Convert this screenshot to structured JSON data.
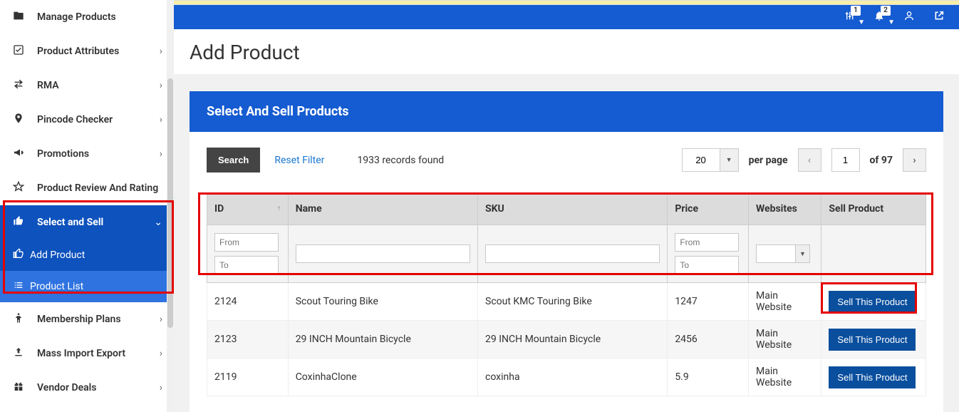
{
  "sidebar": {
    "items": [
      {
        "icon": "folder",
        "label": "Manage Products",
        "hasSub": false
      },
      {
        "icon": "check",
        "label": "Product Attributes",
        "hasSub": true
      },
      {
        "icon": "swap",
        "label": "RMA",
        "hasSub": true
      },
      {
        "icon": "pin",
        "label": "Pincode Checker",
        "hasSub": true
      },
      {
        "icon": "bullhorn",
        "label": "Promotions",
        "hasSub": true
      },
      {
        "icon": "star",
        "label": "Product Review And Rating",
        "hasSub": false
      },
      {
        "icon": "thumbup",
        "label": "Select and Sell",
        "hasSub": true,
        "active": true
      },
      {
        "icon": "body",
        "label": "Membership Plans",
        "hasSub": true
      },
      {
        "icon": "upload",
        "label": "Mass Import Export",
        "hasSub": true
      },
      {
        "icon": "gift",
        "label": "Vendor Deals",
        "hasSub": true
      }
    ],
    "subitems": [
      {
        "icon": "thumbup",
        "label": "Add Product"
      },
      {
        "icon": "list",
        "label": "Product List"
      }
    ]
  },
  "topbar": {
    "badge1": "1",
    "badge2": "2"
  },
  "page": {
    "title": "Add Product",
    "panelTitle": "Select And Sell Products"
  },
  "toolbar": {
    "search": "Search",
    "reset": "Reset Filter",
    "records": "1933 records found",
    "perpage_value": "20",
    "perpage_label": "per page",
    "page_value": "1",
    "page_of": "of 97"
  },
  "grid": {
    "headers": {
      "id": "ID",
      "name": "Name",
      "sku": "SKU",
      "price": "Price",
      "websites": "Websites",
      "sell": "Sell Product"
    },
    "filters": {
      "from": "From",
      "to": "To"
    },
    "rows": [
      {
        "id": "2124",
        "name": "Scout Touring Bike",
        "sku": "Scout KMC Touring Bike",
        "price": "1247",
        "websites": "Main Website",
        "btn": "Sell This Product"
      },
      {
        "id": "2123",
        "name": "29 INCH Mountain Bicycle",
        "sku": "29 INCH Mountain Bicycle",
        "price": "2456",
        "websites": "Main Website",
        "btn": "Sell This Product"
      },
      {
        "id": "2119",
        "name": "CoxinhaClone",
        "sku": "coxinha",
        "price": "5.9",
        "websites": "Main Website",
        "btn": "Sell This Product"
      }
    ]
  }
}
